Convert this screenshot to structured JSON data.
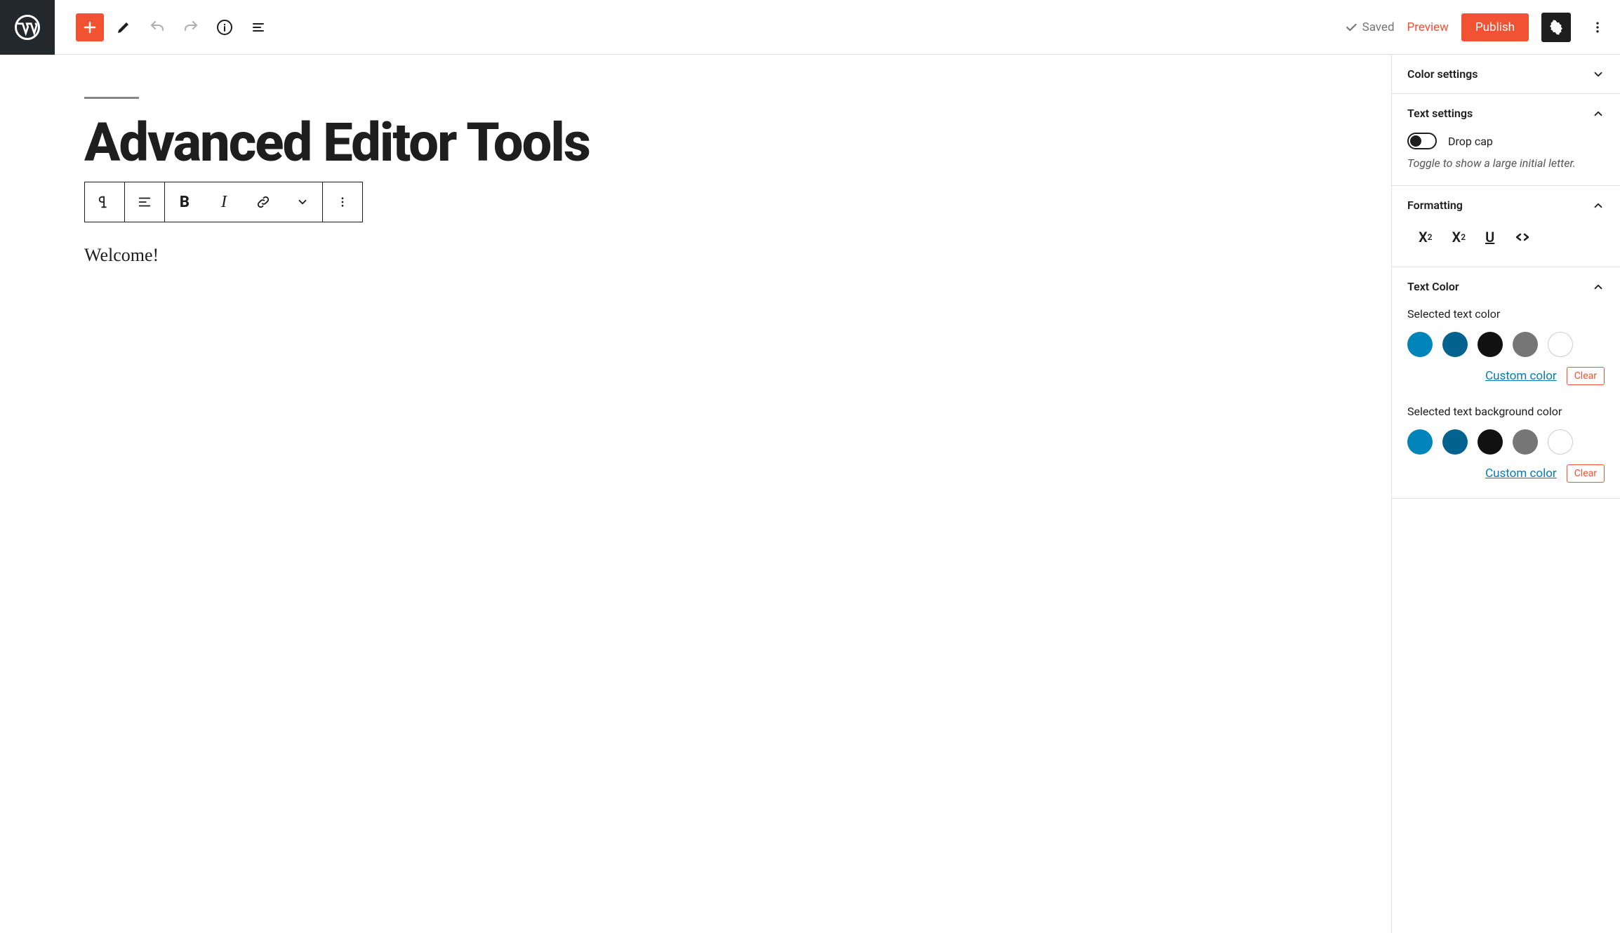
{
  "topbar": {
    "saved_label": "Saved",
    "preview_label": "Preview",
    "publish_label": "Publish"
  },
  "editor": {
    "title": "Advanced Editor Tools",
    "content": "Welcome!"
  },
  "sidebar": {
    "color_settings": {
      "label": "Color settings"
    },
    "text_settings": {
      "label": "Text settings",
      "drop_cap_label": "Drop cap",
      "drop_cap_desc": "Toggle to show a large initial letter."
    },
    "formatting": {
      "label": "Formatting"
    },
    "text_color": {
      "label": "Text Color",
      "selected_label": "Selected text color",
      "bg_label": "Selected text background color",
      "custom_label": "Custom color",
      "clear_label": "Clear",
      "swatches": [
        "#0085ba",
        "#04628f",
        "#111111",
        "#767676",
        "#ffffff"
      ]
    }
  }
}
